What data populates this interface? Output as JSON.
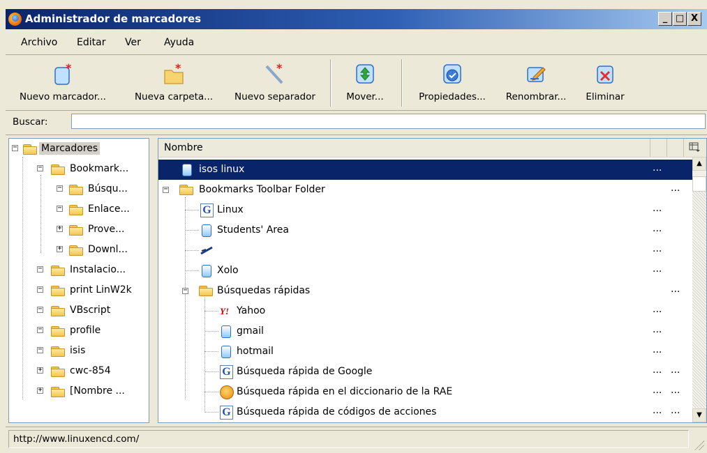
{
  "window": {
    "title": "Administrador de marcadores",
    "controls": [
      "_",
      "□",
      "X"
    ]
  },
  "menu": [
    {
      "label": "Archivo"
    },
    {
      "label": "Editar"
    },
    {
      "label": "Ver"
    },
    {
      "label": "Ayuda"
    }
  ],
  "toolbar": [
    {
      "label": "Nuevo marcador...",
      "icon": "new-bookmark-icon"
    },
    {
      "label": "Nueva carpeta...",
      "icon": "new-folder-icon"
    },
    {
      "label": "Nuevo separador",
      "icon": "new-separator-icon"
    },
    {
      "label": "Mover...",
      "icon": "move-icon"
    },
    {
      "label": "Propiedades...",
      "icon": "properties-icon"
    },
    {
      "label": "Renombrar...",
      "icon": "rename-icon"
    },
    {
      "label": "Eliminar",
      "icon": "delete-icon"
    }
  ],
  "search": {
    "label": "Buscar:",
    "value": ""
  },
  "tree": [
    {
      "label": "Marcadores",
      "expander": "−"
    },
    {
      "label": "Bookmark...",
      "expander": "−"
    },
    {
      "label": "Búsqu...",
      "expander": "−"
    },
    {
      "label": "Enlace...",
      "expander": "−"
    },
    {
      "label": "Prove...",
      "expander": "+"
    },
    {
      "label": "Downl...",
      "expander": "+"
    },
    {
      "label": "Instalacio...",
      "expander": "−"
    },
    {
      "label": "print LinW2k",
      "expander": "−"
    },
    {
      "label": "VBscript",
      "expander": "−"
    },
    {
      "label": "profile",
      "expander": "−"
    },
    {
      "label": "isis",
      "expander": "−"
    },
    {
      "label": "cwc-854",
      "expander": "+"
    },
    {
      "label": "[Nombre ...",
      "expander": "+"
    }
  ],
  "list": {
    "column_name": "Nombre",
    "rows": [
      {
        "name": "isos linux",
        "icon": "bookmark-icon",
        "c2": "...",
        "c3": ""
      },
      {
        "name": "Bookmarks Toolbar Folder",
        "icon": "folder-icon",
        "c2": "",
        "c3": "..."
      },
      {
        "name": "Linux",
        "icon": "google-icon",
        "c2": "...",
        "c3": ""
      },
      {
        "name": "Students' Area",
        "icon": "bookmark-icon",
        "c2": "...",
        "c3": ""
      },
      {
        "name": "",
        "icon": "separator-icon",
        "c2": "...",
        "c3": ""
      },
      {
        "name": "Xolo",
        "icon": "bookmark-icon",
        "c2": "...",
        "c3": ""
      },
      {
        "name": "Búsquedas rápidas",
        "icon": "folder-icon",
        "c2": "",
        "c3": "..."
      },
      {
        "name": "Yahoo",
        "icon": "yahoo-icon",
        "c2": "...",
        "c3": ""
      },
      {
        "name": "gmail",
        "icon": "bookmark-icon",
        "c2": "...",
        "c3": ""
      },
      {
        "name": "hotmail",
        "icon": "bookmark-icon",
        "c2": "...",
        "c3": ""
      },
      {
        "name": "Búsqueda rápida de Google",
        "icon": "google-icon",
        "c2": "...",
        "c3": "..."
      },
      {
        "name": "Búsqueda rápida en el diccionario de la RAE",
        "icon": "rae-icon",
        "c2": "...",
        "c3": "..."
      },
      {
        "name": "Búsqueda rápida de códigos de acciones",
        "icon": "google-icon",
        "c2": "...",
        "c3": "..."
      }
    ]
  },
  "status": {
    "text": "http://www.linuxencd.com/"
  },
  "colors": {
    "selection": "#0A246A",
    "window_bg": "#ECE9D8",
    "title_start": "#0A246A",
    "title_end": "#A6CAF0"
  }
}
